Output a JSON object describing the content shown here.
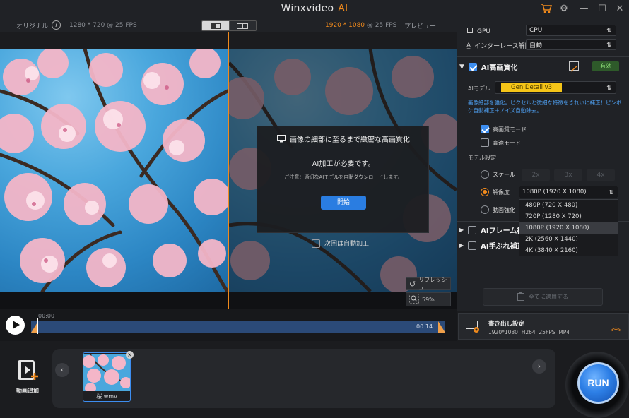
{
  "titlebar": {
    "app_name": "Winxvideo",
    "app_suffix": "AI"
  },
  "preview_header": {
    "left_label": "オリジナル",
    "left_info": "1280 * 720 @ 25 FPS",
    "right_info_highlight": "1920 * 1080",
    "right_info_rest": "@ 25 FPS",
    "right_label": "プレビュー"
  },
  "modal": {
    "title": "画像の細部に至るまで緻密な高画質化",
    "message": "AI加工が必要です。",
    "note": "ご注意：適切なAIモデルを自動ダウンロードします。",
    "start_label": "開始",
    "auto_label": "次回は自動加工"
  },
  "preview_tools": {
    "refresh_label": "リフレッシュ",
    "zoom_label": "59%"
  },
  "timeline": {
    "time_start": "00:00",
    "time_end": "00:14"
  },
  "right_panel": {
    "gpu_label": "GPU",
    "gpu_value": "CPU",
    "deinterlace_label": "インターレース解除",
    "deinterlace_value": "自動",
    "ai_enhance_title": "AI高画質化",
    "ai_enhance_status": "有効",
    "ai_model_label": "AIモデル",
    "ai_model_value": "Gen Detail v3",
    "ai_model_desc": "画像細部を強化。ピクセルと微細な特徴をきれいに補正！ピンボケ自動補正＋ノイズ自動除去。",
    "mode_hq_label": "高画質モード",
    "mode_fast_label": "高速モード",
    "model_settings_label": "モデル設定",
    "scale_label": "スケール",
    "scale_options": [
      "2x",
      "3x",
      "4x"
    ],
    "resolution_label": "解像度",
    "resolution_value": "1080P (1920 X 1080)",
    "video_enhance_label": "動画強化",
    "resolution_options": [
      "480P (720 X 480)",
      "720P (1280 X 720)",
      "1080P (1920 X 1080)",
      "2K (2560 X 1440)",
      "4K (3840 X 2160)"
    ],
    "frame_interp_title": "AIフレーム補",
    "stabilize_title": "AI手ぶれ補正",
    "apply_all_label": "全てに適用する"
  },
  "export": {
    "title": "書き出し設定",
    "details": "1920*1080  H264  25FPS  MP4"
  },
  "media": {
    "add_video_label": "動画追加",
    "thumb_name": "桜.wmv",
    "run_label": "RUN"
  },
  "colors": {
    "accent": "#f08a1c",
    "primary": "#2a7de1",
    "enabled": "#2e5a2a"
  }
}
